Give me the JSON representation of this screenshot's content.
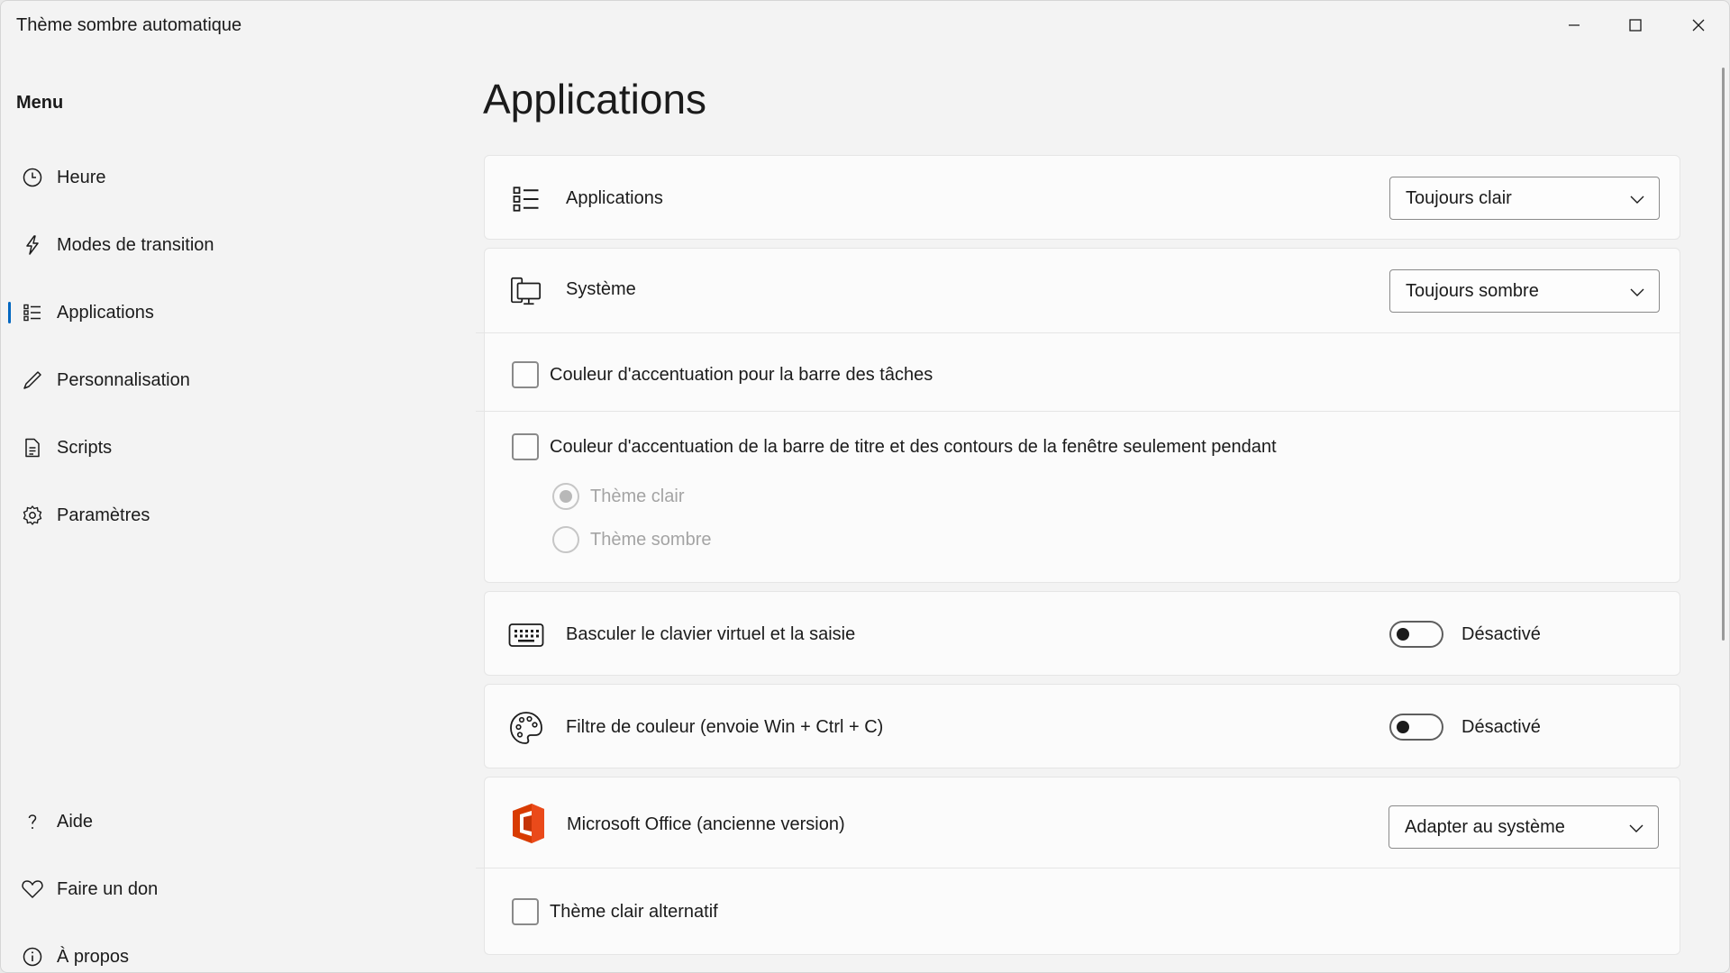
{
  "window": {
    "title": "Thème sombre automatique",
    "controls": [
      "minimize-icon",
      "maximize-icon",
      "close-icon"
    ]
  },
  "sidebar": {
    "menu_title": "Menu",
    "items": [
      {
        "label": "Heure",
        "icon": "clock-icon"
      },
      {
        "label": "Modes de transition",
        "icon": "lightning-icon"
      },
      {
        "label": "Applications",
        "icon": "list-icon",
        "active": true
      },
      {
        "label": "Personnalisation",
        "icon": "pen-icon"
      },
      {
        "label": "Scripts",
        "icon": "document-icon"
      },
      {
        "label": "Paramètres",
        "icon": "gear-icon"
      }
    ],
    "footer_items": [
      {
        "label": "Aide",
        "icon": "question-icon"
      },
      {
        "label": "Faire un don",
        "icon": "heart-icon"
      },
      {
        "label": "À propos",
        "icon": "info-icon"
      }
    ]
  },
  "main": {
    "page_title": "Applications",
    "applications": {
      "label": "Applications",
      "icon": "list-icon",
      "selected": "Toujours clair"
    },
    "system": {
      "label": "Système",
      "icon": "system-icon",
      "selected": "Toujours sombre"
    },
    "taskbar_accent": {
      "label": "Couleur d'accentuation pour la barre des tâches",
      "checked": false
    },
    "titlebar_accent": {
      "label": "Couleur d'accentuation de la barre de titre et des contours de la fenêtre seulement pendant",
      "checked": false,
      "options": [
        {
          "label": "Thème clair",
          "selected": true,
          "disabled": true
        },
        {
          "label": "Thème sombre",
          "selected": false,
          "disabled": true
        }
      ]
    },
    "touch_keyboard": {
      "label": "Basculer le clavier virtuel et la saisie",
      "icon": "keyboard-icon",
      "state": "Désactivé",
      "on": false
    },
    "color_filter": {
      "label": "Filtre de couleur (envoie Win + Ctrl + C)",
      "icon": "palette-icon",
      "state": "Désactivé",
      "on": false
    },
    "office": {
      "label": "Microsoft Office (ancienne version)",
      "icon": "office-icon",
      "selected": "Adapter au système"
    },
    "alt_light": {
      "label": "Thème clair alternatif",
      "checked": false
    }
  },
  "colors": {
    "accent": "#0067c0",
    "office_red": "#d83b01",
    "background": "#f3f3f3",
    "card": "#fbfbfb"
  }
}
